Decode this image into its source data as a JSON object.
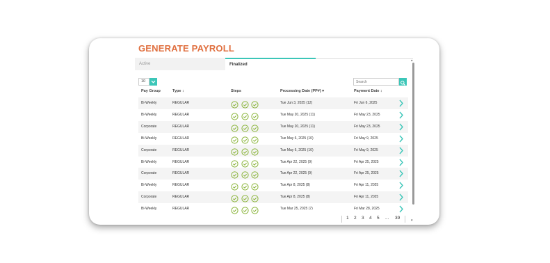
{
  "page": {
    "title": "GENERATE PAYROLL"
  },
  "tabs": [
    {
      "label": "Active"
    },
    {
      "label": "Finalized"
    }
  ],
  "controls": {
    "page_size": "10",
    "search_placeholder": "Search"
  },
  "table": {
    "columns": [
      {
        "label": "Pay Group"
      },
      {
        "label": "Type ↕"
      },
      {
        "label": "Steps"
      },
      {
        "label": "Processing Date (PP#) ▾"
      },
      {
        "label": "Payment Date ↕"
      }
    ],
    "rows": [
      {
        "group": "Bi-Weekly",
        "type": "REGULAR",
        "processing": "Tue Jun 3, 2025 (12)",
        "payment": "Fri Jun 6, 2025"
      },
      {
        "group": "Bi-Weekly",
        "type": "REGULAR",
        "processing": "Tue May 20, 2025 (11)",
        "payment": "Fri May 23, 2025"
      },
      {
        "group": "Corporate",
        "type": "REGULAR",
        "processing": "Tue May 20, 2025 (11)",
        "payment": "Fri May 23, 2025"
      },
      {
        "group": "Bi-Weekly",
        "type": "REGULAR",
        "processing": "Tue May 6, 2025 (10)",
        "payment": "Fri May 9, 2025"
      },
      {
        "group": "Corporate",
        "type": "REGULAR",
        "processing": "Tue May 6, 2025 (10)",
        "payment": "Fri May 9, 2025"
      },
      {
        "group": "Bi-Weekly",
        "type": "REGULAR",
        "processing": "Tue Apr 22, 2025 (9)",
        "payment": "Fri Apr 25, 2025"
      },
      {
        "group": "Corporate",
        "type": "REGULAR",
        "processing": "Tue Apr 22, 2025 (9)",
        "payment": "Fri Apr 25, 2025"
      },
      {
        "group": "Bi-Weekly",
        "type": "REGULAR",
        "processing": "Tue Apr 8, 2025 (8)",
        "payment": "Fri Apr 11, 2025"
      },
      {
        "group": "Corporate",
        "type": "REGULAR",
        "processing": "Tue Apr 8, 2025 (8)",
        "payment": "Fri Apr 11, 2025"
      },
      {
        "group": "Bi-Weekly",
        "type": "REGULAR",
        "processing": "Tue Mar 25, 2025 (7)",
        "payment": "Fri Mar 28, 2025"
      }
    ]
  },
  "pagination": {
    "pages": [
      "1",
      "2",
      "3",
      "4",
      "5",
      "...",
      "39"
    ]
  },
  "icons": {
    "step": "check-circle-icon",
    "open": "chevron-right-icon"
  },
  "colors": {
    "accent": "#3cc6b8",
    "title": "#e07040",
    "step_check": "#8ab43a"
  }
}
